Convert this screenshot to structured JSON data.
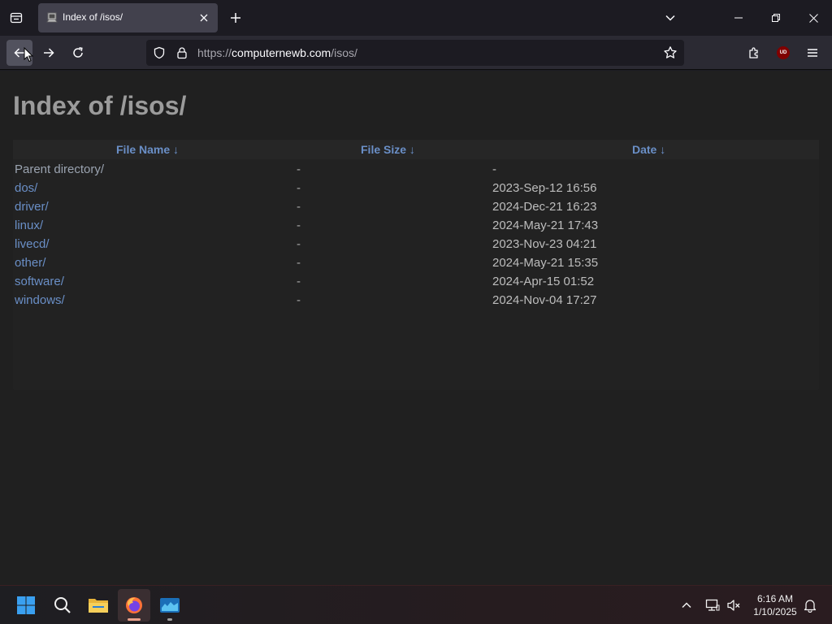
{
  "browser": {
    "tab": {
      "title": "Index of /isos/"
    },
    "url": {
      "host": "computernewb.com",
      "path": "/isos/",
      "scheme": "https://"
    }
  },
  "page": {
    "heading": "Index of /isos/",
    "columns": {
      "name": "File Name  ↓",
      "size": "File Size  ↓",
      "date": "Date  ↓"
    },
    "rows": [
      {
        "name": "Parent directory/",
        "size": "-",
        "date": "-"
      },
      {
        "name": "dos/",
        "size": "-",
        "date": "2023-Sep-12 16:56"
      },
      {
        "name": "driver/",
        "size": "-",
        "date": "2024-Dec-21 16:23"
      },
      {
        "name": "linux/",
        "size": "-",
        "date": "2024-May-21 17:43"
      },
      {
        "name": "livecd/",
        "size": "-",
        "date": "2023-Nov-23 04:21"
      },
      {
        "name": "other/",
        "size": "-",
        "date": "2024-May-21 15:35"
      },
      {
        "name": "software/",
        "size": "-",
        "date": "2024-Apr-15 01:52"
      },
      {
        "name": "windows/",
        "size": "-",
        "date": "2024-Nov-04 17:27"
      }
    ]
  },
  "taskbar": {
    "time": "6:16 AM",
    "date": "1/10/2025",
    "extension_badge": "UD"
  },
  "colors": {
    "link": "#6a8fc7",
    "heading": "#9b9b9b",
    "page_bg": "#202020",
    "toolbar_bg": "#2b2a33"
  }
}
